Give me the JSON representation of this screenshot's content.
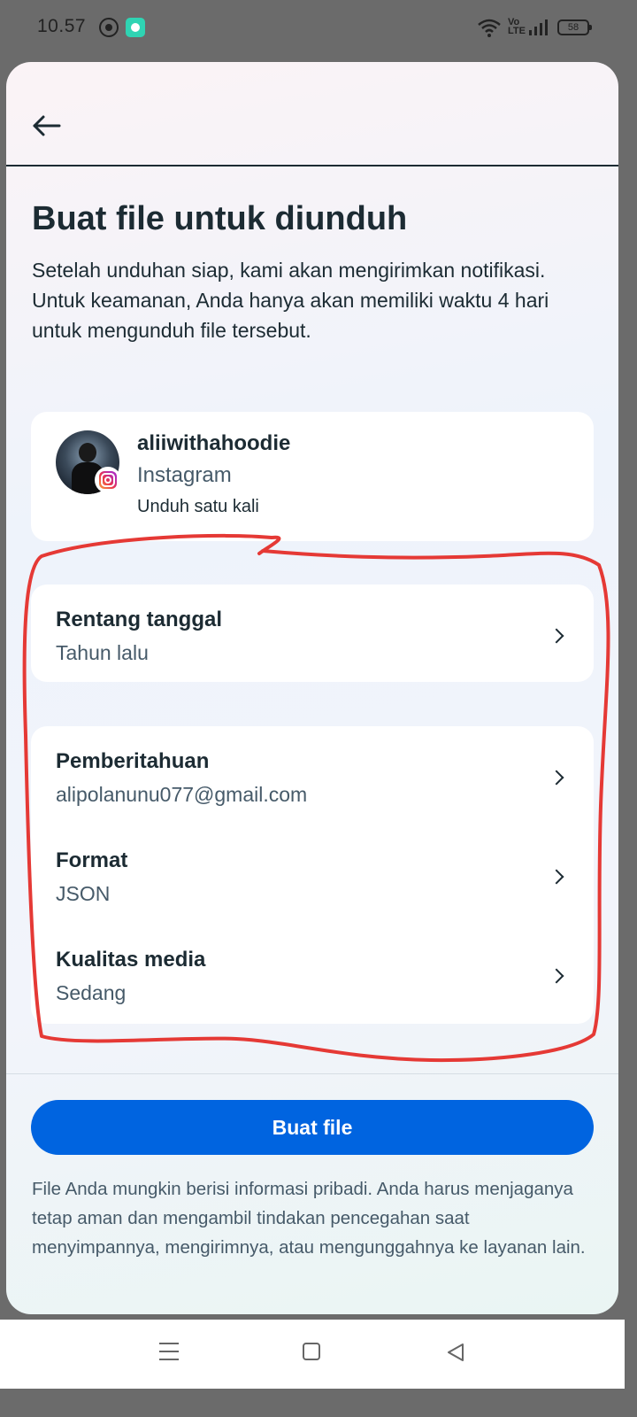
{
  "status_bar": {
    "time": "10.57",
    "battery": "58",
    "volte": "Vo LTE",
    "icons": [
      "whatsapp-icon",
      "app-notification-icon",
      "wifi-icon",
      "volte-icon",
      "signal-icon",
      "battery-icon"
    ]
  },
  "header": {
    "back_icon": "arrow-left-icon"
  },
  "page": {
    "title": "Buat file untuk diunduh",
    "description": "Setelah unduhan siap, kami akan mengirimkan notifikasi. Untuk keamanan, Anda hanya akan memiliki waktu 4 hari untuk mengunduh file tersebut."
  },
  "account": {
    "username": "aliiwithahoodie",
    "platform": "Instagram",
    "mode": "Unduh satu kali"
  },
  "date_range": {
    "title": "Rentang tanggal",
    "value": "Tahun lalu"
  },
  "settings": [
    {
      "title": "Pemberitahuan",
      "value": "alipolanunu077@gmail.com"
    },
    {
      "title": "Format",
      "value": "JSON"
    },
    {
      "title": "Kualitas media",
      "value": "Sedang"
    }
  ],
  "action": {
    "button_label": "Buat file"
  },
  "disclaimer": "File Anda mungkin berisi informasi pribadi. Anda harus menjaganya tetap aman dan mengambil tindakan pencegahan saat menyimpannya, mengirimnya, atau mengunggahnya ke layanan lain.",
  "colors": {
    "primary": "#0064e0",
    "text": "#1c2b33",
    "secondary_text": "#465a69",
    "annotation": "#e53935"
  }
}
